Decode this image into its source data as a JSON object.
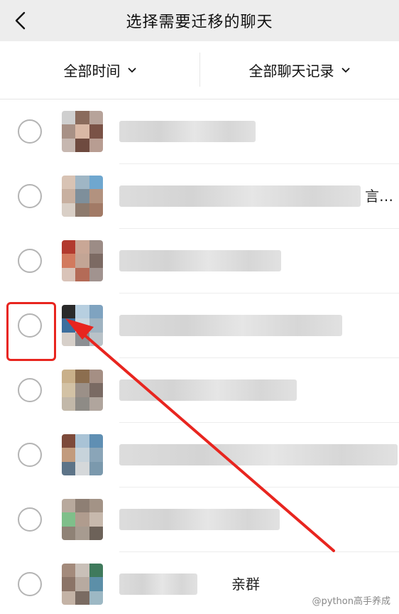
{
  "header": {
    "title": "选择需要迁移的聊天",
    "back_icon": "chevron-left-icon"
  },
  "filters": [
    {
      "label": "全部时间",
      "icon": "chevron-down-icon"
    },
    {
      "label": "全部聊天记录",
      "icon": "chevron-down-icon"
    }
  ],
  "chats": [
    {
      "name": "",
      "selected": false
    },
    {
      "name": "",
      "name_suffix": "言…",
      "selected": false
    },
    {
      "name": "",
      "selected": false
    },
    {
      "name": "",
      "selected": false
    },
    {
      "name": "",
      "selected": false
    },
    {
      "name": "",
      "selected": false
    },
    {
      "name": "",
      "selected": false
    },
    {
      "name": "",
      "name_suffix": "亲群",
      "selected": false
    }
  ],
  "annotation": {
    "color": "#e8251f"
  },
  "watermark": {
    "text": "@python高手养成"
  },
  "colors": {
    "header_bg": "#ededed",
    "radio_border": "#b4b4b4",
    "divider": "#ededed"
  }
}
